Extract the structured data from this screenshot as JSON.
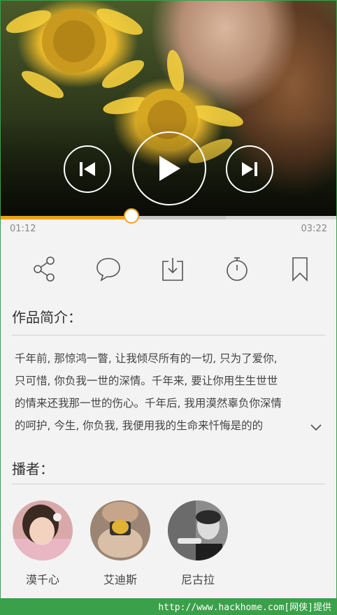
{
  "player": {
    "current_time": "01:12",
    "total_time": "03:22",
    "progress": 0.39,
    "buffered": 0.67,
    "accent": "#f2a21b"
  },
  "actions": [
    {
      "name": "share-icon"
    },
    {
      "name": "comment-icon"
    },
    {
      "name": "download-icon"
    },
    {
      "name": "timer-icon"
    },
    {
      "name": "bookmark-icon"
    }
  ],
  "intro": {
    "title": "作品简介：",
    "lines": [
      "千年前, 那惊鸿一瞥, 让我倾尽所有的一切, 只为了爱你,",
      "只可惜, 你负我一世的深情。千年来, 要让你用生生世世",
      "的情来还我那一世的伤心。千年后, 我用漠然辜负你深情",
      "的呵护, 今生, 你负我, 我便用我的生命来忏悔是的的"
    ]
  },
  "hosts": {
    "title": "播者：",
    "items": [
      {
        "name": "漠千心"
      },
      {
        "name": "艾迪斯"
      },
      {
        "name": "尼古拉"
      }
    ]
  },
  "footer": {
    "text": "http://www.hackhome.com[网侠]提供"
  }
}
